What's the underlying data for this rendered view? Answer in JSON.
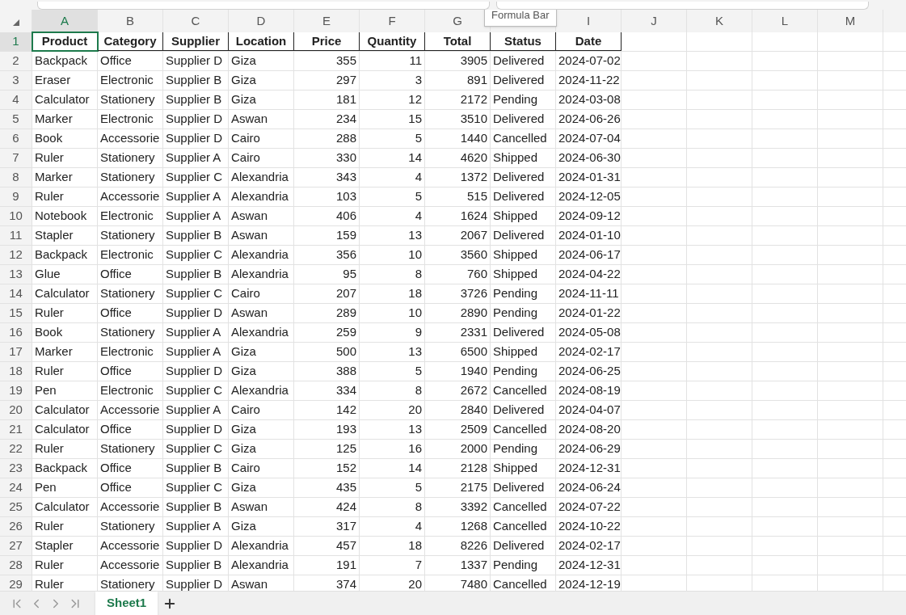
{
  "columns": [
    {
      "kind": "letter",
      "text": "A",
      "selected": true
    },
    {
      "kind": "letter",
      "text": "B",
      "selected": false
    },
    {
      "kind": "letter",
      "text": "C",
      "selected": false
    },
    {
      "kind": "letter",
      "text": "D",
      "selected": false
    },
    {
      "kind": "letter",
      "text": "E",
      "selected": false
    },
    {
      "kind": "letter",
      "text": "F",
      "selected": false
    },
    {
      "kind": "letter",
      "text": "G",
      "selected": false
    },
    {
      "kind": "covered",
      "selected": false
    },
    {
      "kind": "letter",
      "text": "I",
      "selected": false
    },
    {
      "kind": "letter",
      "text": "J",
      "selected": false
    },
    {
      "kind": "letter",
      "text": "K",
      "selected": false
    },
    {
      "kind": "letter",
      "text": "L",
      "selected": false
    },
    {
      "kind": "letter",
      "text": "M",
      "selected": false
    }
  ],
  "tooltip": {
    "text": "Formula Bar"
  },
  "rows": [
    {
      "number": "1",
      "kind": "header",
      "selected": true,
      "cells": [
        "Product",
        "Category",
        "Supplier",
        "Location",
        "Price",
        "Quantity",
        "Total",
        "Status",
        "Date"
      ]
    },
    {
      "number": "2",
      "kind": "data",
      "selected": false,
      "cells": [
        "Backpack",
        "Office",
        "Supplier D",
        "Giza",
        "355",
        "11",
        "3905",
        "Delivered",
        "2024-07-02"
      ]
    },
    {
      "number": "3",
      "kind": "data",
      "selected": false,
      "cells": [
        "Eraser",
        "Electronic",
        "Supplier B",
        "Giza",
        "297",
        "3",
        "891",
        "Delivered",
        "2024-11-22"
      ]
    },
    {
      "number": "4",
      "kind": "data",
      "selected": false,
      "cells": [
        "Calculator",
        "Stationery",
        "Supplier B",
        "Giza",
        "181",
        "12",
        "2172",
        "Pending",
        "2024-03-08"
      ]
    },
    {
      "number": "5",
      "kind": "data",
      "selected": false,
      "cells": [
        "Marker",
        "Electronic",
        "Supplier D",
        "Aswan",
        "234",
        "15",
        "3510",
        "Delivered",
        "2024-06-26"
      ]
    },
    {
      "number": "6",
      "kind": "data",
      "selected": false,
      "cells": [
        "Book",
        "Accessorie",
        "Supplier D",
        "Cairo",
        "288",
        "5",
        "1440",
        "Cancelled",
        "2024-07-04"
      ]
    },
    {
      "number": "7",
      "kind": "data",
      "selected": false,
      "cells": [
        "Ruler",
        "Stationery",
        "Supplier A",
        "Cairo",
        "330",
        "14",
        "4620",
        "Shipped",
        "2024-06-30"
      ]
    },
    {
      "number": "8",
      "kind": "data",
      "selected": false,
      "cells": [
        "Marker",
        "Stationery",
        "Supplier C",
        "Alexandria",
        "343",
        "4",
        "1372",
        "Delivered",
        "2024-01-31"
      ]
    },
    {
      "number": "9",
      "kind": "data",
      "selected": false,
      "cells": [
        "Ruler",
        "Accessorie",
        "Supplier A",
        "Alexandria",
        "103",
        "5",
        "515",
        "Delivered",
        "2024-12-05"
      ]
    },
    {
      "number": "10",
      "kind": "data",
      "selected": false,
      "cells": [
        "Notebook",
        "Electronic",
        "Supplier A",
        "Aswan",
        "406",
        "4",
        "1624",
        "Shipped",
        "2024-09-12"
      ]
    },
    {
      "number": "11",
      "kind": "data",
      "selected": false,
      "cells": [
        "Stapler",
        "Stationery",
        "Supplier B",
        "Aswan",
        "159",
        "13",
        "2067",
        "Delivered",
        "2024-01-10"
      ]
    },
    {
      "number": "12",
      "kind": "data",
      "selected": false,
      "cells": [
        "Backpack",
        "Electronic",
        "Supplier C",
        "Alexandria",
        "356",
        "10",
        "3560",
        "Shipped",
        "2024-06-17"
      ]
    },
    {
      "number": "13",
      "kind": "data",
      "selected": false,
      "cells": [
        "Glue",
        "Office",
        "Supplier B",
        "Alexandria",
        "95",
        "8",
        "760",
        "Shipped",
        "2024-04-22"
      ]
    },
    {
      "number": "14",
      "kind": "data",
      "selected": false,
      "cells": [
        "Calculator",
        "Stationery",
        "Supplier C",
        "Cairo",
        "207",
        "18",
        "3726",
        "Pending",
        "2024-11-11"
      ]
    },
    {
      "number": "15",
      "kind": "data",
      "selected": false,
      "cells": [
        "Ruler",
        "Office",
        "Supplier D",
        "Aswan",
        "289",
        "10",
        "2890",
        "Pending",
        "2024-01-22"
      ]
    },
    {
      "number": "16",
      "kind": "data",
      "selected": false,
      "cells": [
        "Book",
        "Stationery",
        "Supplier A",
        "Alexandria",
        "259",
        "9",
        "2331",
        "Delivered",
        "2024-05-08"
      ]
    },
    {
      "number": "17",
      "kind": "data",
      "selected": false,
      "cells": [
        "Marker",
        "Electronic",
        "Supplier A",
        "Giza",
        "500",
        "13",
        "6500",
        "Shipped",
        "2024-02-17"
      ]
    },
    {
      "number": "18",
      "kind": "data",
      "selected": false,
      "cells": [
        "Ruler",
        "Office",
        "Supplier D",
        "Giza",
        "388",
        "5",
        "1940",
        "Pending",
        "2024-06-25"
      ]
    },
    {
      "number": "19",
      "kind": "data",
      "selected": false,
      "cells": [
        "Pen",
        "Electronic",
        "Supplier C",
        "Alexandria",
        "334",
        "8",
        "2672",
        "Cancelled",
        "2024-08-19"
      ]
    },
    {
      "number": "20",
      "kind": "data",
      "selected": false,
      "cells": [
        "Calculator",
        "Accessorie",
        "Supplier A",
        "Cairo",
        "142",
        "20",
        "2840",
        "Delivered",
        "2024-04-07"
      ]
    },
    {
      "number": "21",
      "kind": "data",
      "selected": false,
      "cells": [
        "Calculator",
        "Office",
        "Supplier D",
        "Giza",
        "193",
        "13",
        "2509",
        "Cancelled",
        "2024-08-20"
      ]
    },
    {
      "number": "22",
      "kind": "data",
      "selected": false,
      "cells": [
        "Ruler",
        "Stationery",
        "Supplier C",
        "Giza",
        "125",
        "16",
        "2000",
        "Pending",
        "2024-06-29"
      ]
    },
    {
      "number": "23",
      "kind": "data",
      "selected": false,
      "cells": [
        "Backpack",
        "Office",
        "Supplier B",
        "Cairo",
        "152",
        "14",
        "2128",
        "Shipped",
        "2024-12-31"
      ]
    },
    {
      "number": "24",
      "kind": "data",
      "selected": false,
      "cells": [
        "Pen",
        "Office",
        "Supplier C",
        "Giza",
        "435",
        "5",
        "2175",
        "Delivered",
        "2024-06-24"
      ]
    },
    {
      "number": "25",
      "kind": "data",
      "selected": false,
      "cells": [
        "Calculator",
        "Accessorie",
        "Supplier B",
        "Aswan",
        "424",
        "8",
        "3392",
        "Cancelled",
        "2024-07-22"
      ]
    },
    {
      "number": "26",
      "kind": "data",
      "selected": false,
      "cells": [
        "Ruler",
        "Stationery",
        "Supplier A",
        "Giza",
        "317",
        "4",
        "1268",
        "Cancelled",
        "2024-10-22"
      ]
    },
    {
      "number": "27",
      "kind": "data",
      "selected": false,
      "cells": [
        "Stapler",
        "Accessorie",
        "Supplier D",
        "Alexandria",
        "457",
        "18",
        "8226",
        "Delivered",
        "2024-02-17"
      ]
    },
    {
      "number": "28",
      "kind": "data",
      "selected": false,
      "cells": [
        "Ruler",
        "Accessorie",
        "Supplier B",
        "Alexandria",
        "191",
        "7",
        "1337",
        "Pending",
        "2024-12-31"
      ]
    },
    {
      "number": "29",
      "kind": "data",
      "selected": false,
      "cells": [
        "Ruler",
        "Stationery",
        "Supplier D",
        "Aswan",
        "374",
        "20",
        "7480",
        "Cancelled",
        "2024-12-19"
      ]
    }
  ],
  "sheet_tabs": [
    {
      "label": "Sheet1",
      "selected": true
    }
  ]
}
